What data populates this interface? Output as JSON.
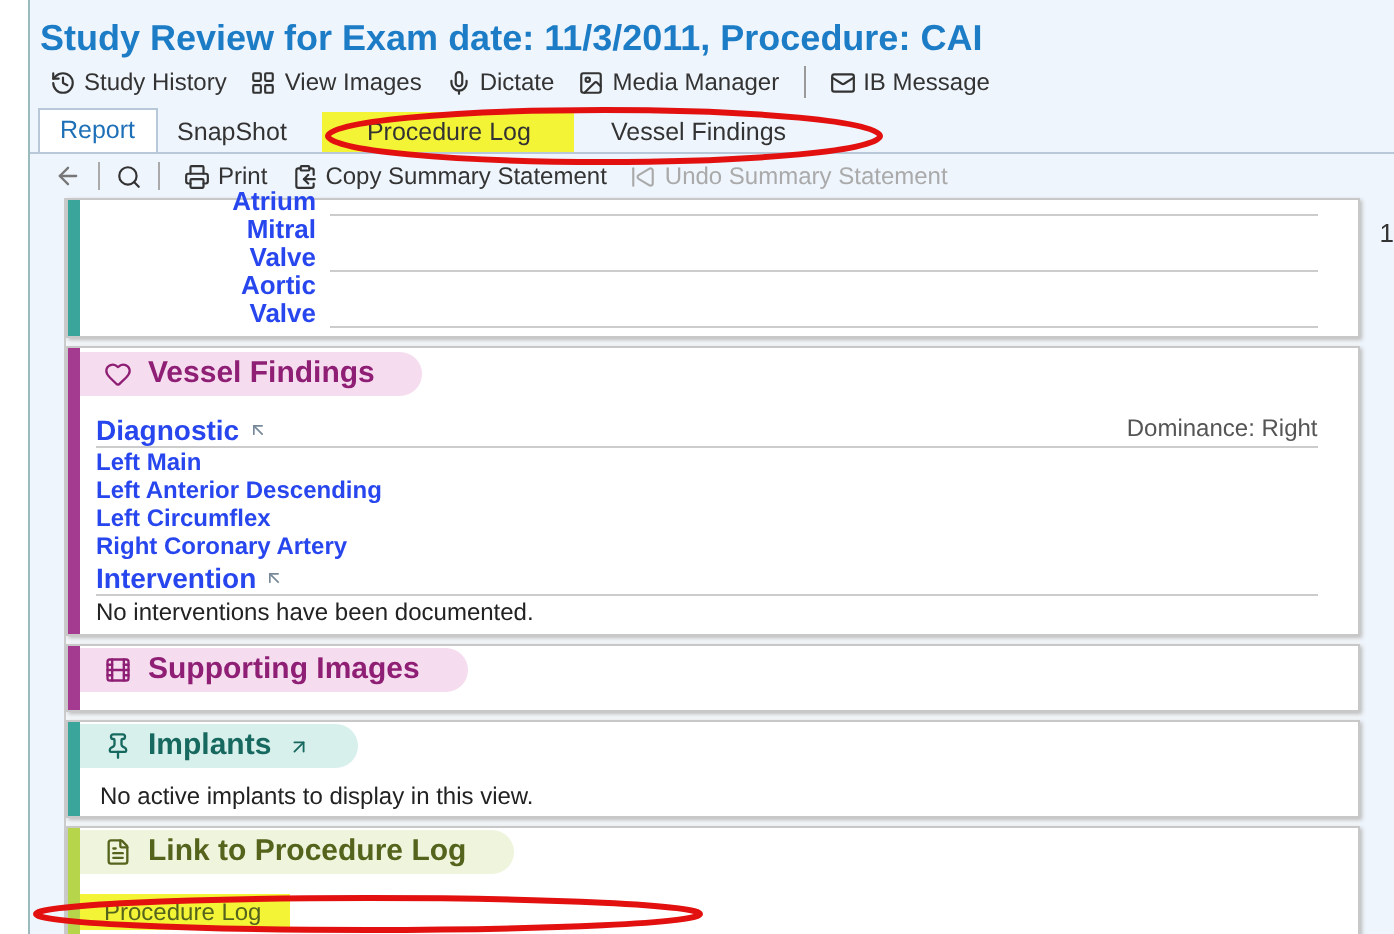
{
  "window": {
    "title": "Study Review for Exam date: 11/3/2011, Procedure: CAI"
  },
  "toolbar": [
    {
      "label": "Study History"
    },
    {
      "label": "View Images"
    },
    {
      "label": "Dictate"
    },
    {
      "label": "Media Manager"
    },
    {
      "label": "IB Message"
    }
  ],
  "tabs": [
    {
      "label": "Report",
      "selected": true,
      "highlighted": false
    },
    {
      "label": "SnapShot",
      "selected": false,
      "highlighted": false
    },
    {
      "label": "Procedure Log",
      "selected": false,
      "highlighted": true
    },
    {
      "label": "Vessel Findings",
      "selected": false,
      "highlighted": false
    }
  ],
  "report_toolbar": [
    {
      "kind": "back"
    },
    {
      "kind": "search"
    },
    {
      "kind": "action",
      "label": "Print",
      "disabled": false
    },
    {
      "kind": "action",
      "label": "Copy Summary Statement",
      "disabled": false
    },
    {
      "kind": "action",
      "label": "Undo Summary Statement",
      "disabled": true
    }
  ],
  "scroll_edge_text": "1",
  "measurements": [
    {
      "label": "Atrium"
    },
    {
      "label": "Mitral Valve"
    },
    {
      "label": "Aortic Valve"
    }
  ],
  "vessel_findings": {
    "title": "Vessel Findings",
    "diagnostic": "Diagnostic",
    "dominance": "Dominance: Right",
    "vessels": [
      "Left Main",
      "Left Anterior Descending",
      "Left Circumflex",
      "Right Coronary Artery"
    ],
    "intervention": "Intervention",
    "intervention_note": "No interventions have been documented."
  },
  "supporting_images": {
    "title": "Supporting Images"
  },
  "implants": {
    "title": "Implants",
    "note": "No active implants to display in this view."
  },
  "procedure_log_link": {
    "title": "Link to Procedure Log",
    "link": "Procedure Log",
    "highlighted": true
  }
}
